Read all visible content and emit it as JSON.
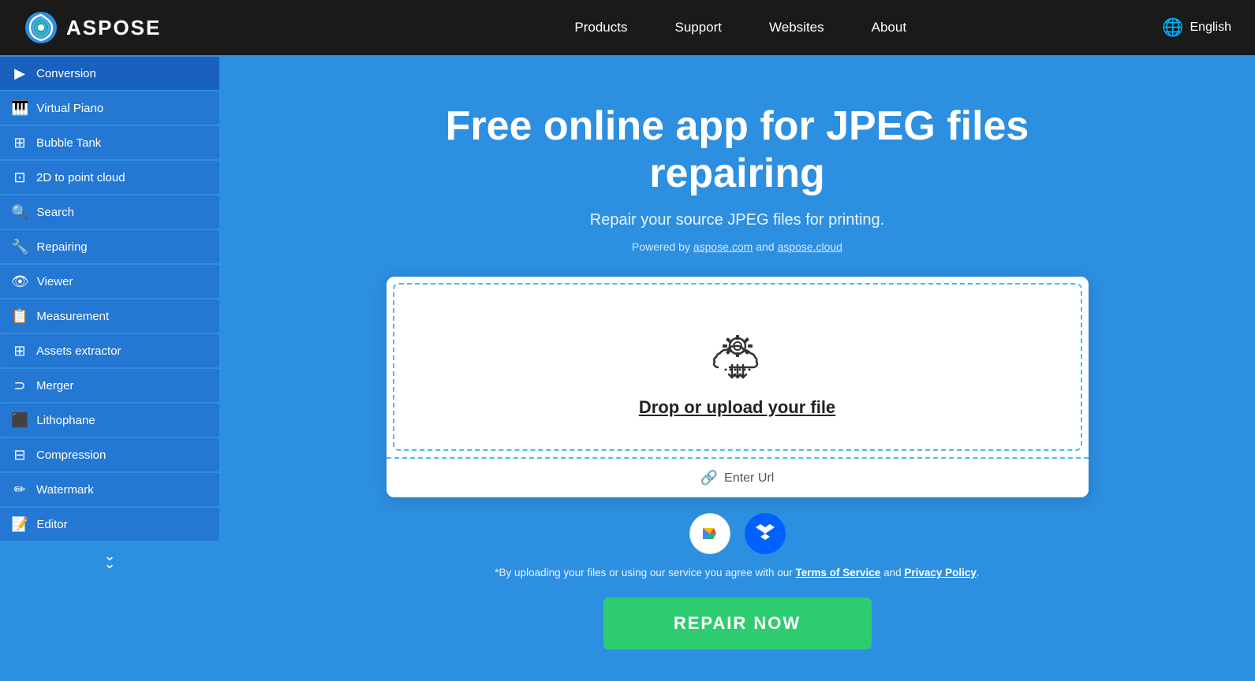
{
  "header": {
    "logo_text": "ASPOSE",
    "nav": {
      "products": "Products",
      "support": "Support",
      "websites": "Websites",
      "about": "About"
    },
    "language": "English"
  },
  "sidebar": {
    "items": [
      {
        "id": "conversion",
        "label": "Conversion",
        "icon": "▶"
      },
      {
        "id": "virtual-piano",
        "label": "Virtual Piano",
        "icon": "🎹"
      },
      {
        "id": "bubble-tank",
        "label": "Bubble Tank",
        "icon": "⊞"
      },
      {
        "id": "2d-to-point-cloud",
        "label": "2D to point cloud",
        "icon": "⊡"
      },
      {
        "id": "search",
        "label": "Search",
        "icon": "🔍"
      },
      {
        "id": "repairing",
        "label": "Repairing",
        "icon": "🔧"
      },
      {
        "id": "viewer",
        "label": "Viewer",
        "icon": "👁"
      },
      {
        "id": "measurement",
        "label": "Measurement",
        "icon": "📋"
      },
      {
        "id": "assets-extractor",
        "label": "Assets extractor",
        "icon": "⊞"
      },
      {
        "id": "merger",
        "label": "Merger",
        "icon": "⊃"
      },
      {
        "id": "lithophane",
        "label": "Lithophane",
        "icon": "⬛"
      },
      {
        "id": "compression",
        "label": "Compression",
        "icon": "⊟"
      },
      {
        "id": "watermark",
        "label": "Watermark",
        "icon": "✏"
      },
      {
        "id": "editor",
        "label": "Editor",
        "icon": "📝"
      }
    ],
    "more_icon": "⌄⌄"
  },
  "main": {
    "title": "Free online app for JPEG files repairing",
    "subtitle": "Repair your source JPEG files for printing.",
    "powered_by_prefix": "Powered by ",
    "aspose_com": "aspose.com",
    "powered_by_and": " and ",
    "aspose_cloud": "aspose.cloud",
    "drop_text": "Drop or upload your file",
    "enter_url": "Enter Url",
    "terms_prefix": "*By uploading your files or using our service you agree with our ",
    "terms_link": "Terms of Service",
    "terms_and": " and ",
    "privacy_link": "Privacy Policy",
    "terms_suffix": ".",
    "repair_button": "REPAIR NOW"
  }
}
